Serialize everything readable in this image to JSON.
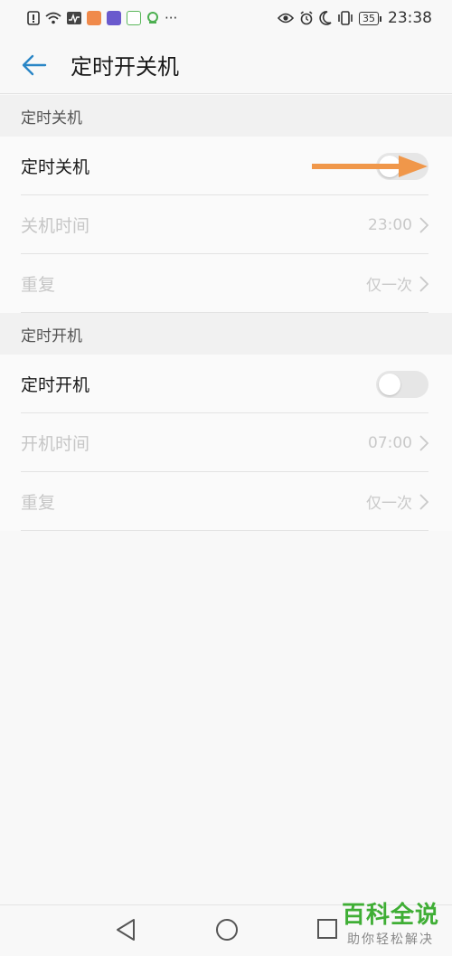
{
  "status_bar": {
    "time": "23:38",
    "battery": "35",
    "left_icons": [
      "alert-icon",
      "wifi-icon",
      "activity-icon",
      "app-icon-orange",
      "app-icon-purple",
      "app-icon-green",
      "app-icon-leaf"
    ],
    "more": "···",
    "right_icons": [
      "eye-icon",
      "alarm-icon",
      "moon-icon",
      "vibrate-icon"
    ]
  },
  "header": {
    "title": "定时开关机"
  },
  "sections": [
    {
      "title": "定时关机",
      "toggle_row": {
        "label": "定时关机",
        "on": false
      },
      "time_row": {
        "label": "关机时间",
        "value": "23:00"
      },
      "repeat_row": {
        "label": "重复",
        "value": "仅一次"
      }
    },
    {
      "title": "定时开机",
      "toggle_row": {
        "label": "定时开机",
        "on": false
      },
      "time_row": {
        "label": "开机时间",
        "value": "07:00"
      },
      "repeat_row": {
        "label": "重复",
        "value": "仅一次"
      }
    }
  ],
  "annotation": {
    "arrow_color": "#f0974a"
  },
  "navbar": {
    "buttons": [
      "back-triangle-icon",
      "home-circle-icon",
      "recent-square-icon"
    ]
  },
  "watermark": {
    "main": "百科全说",
    "sub": "助你轻松解决"
  },
  "colors": {
    "accent": "#2a86c6"
  }
}
